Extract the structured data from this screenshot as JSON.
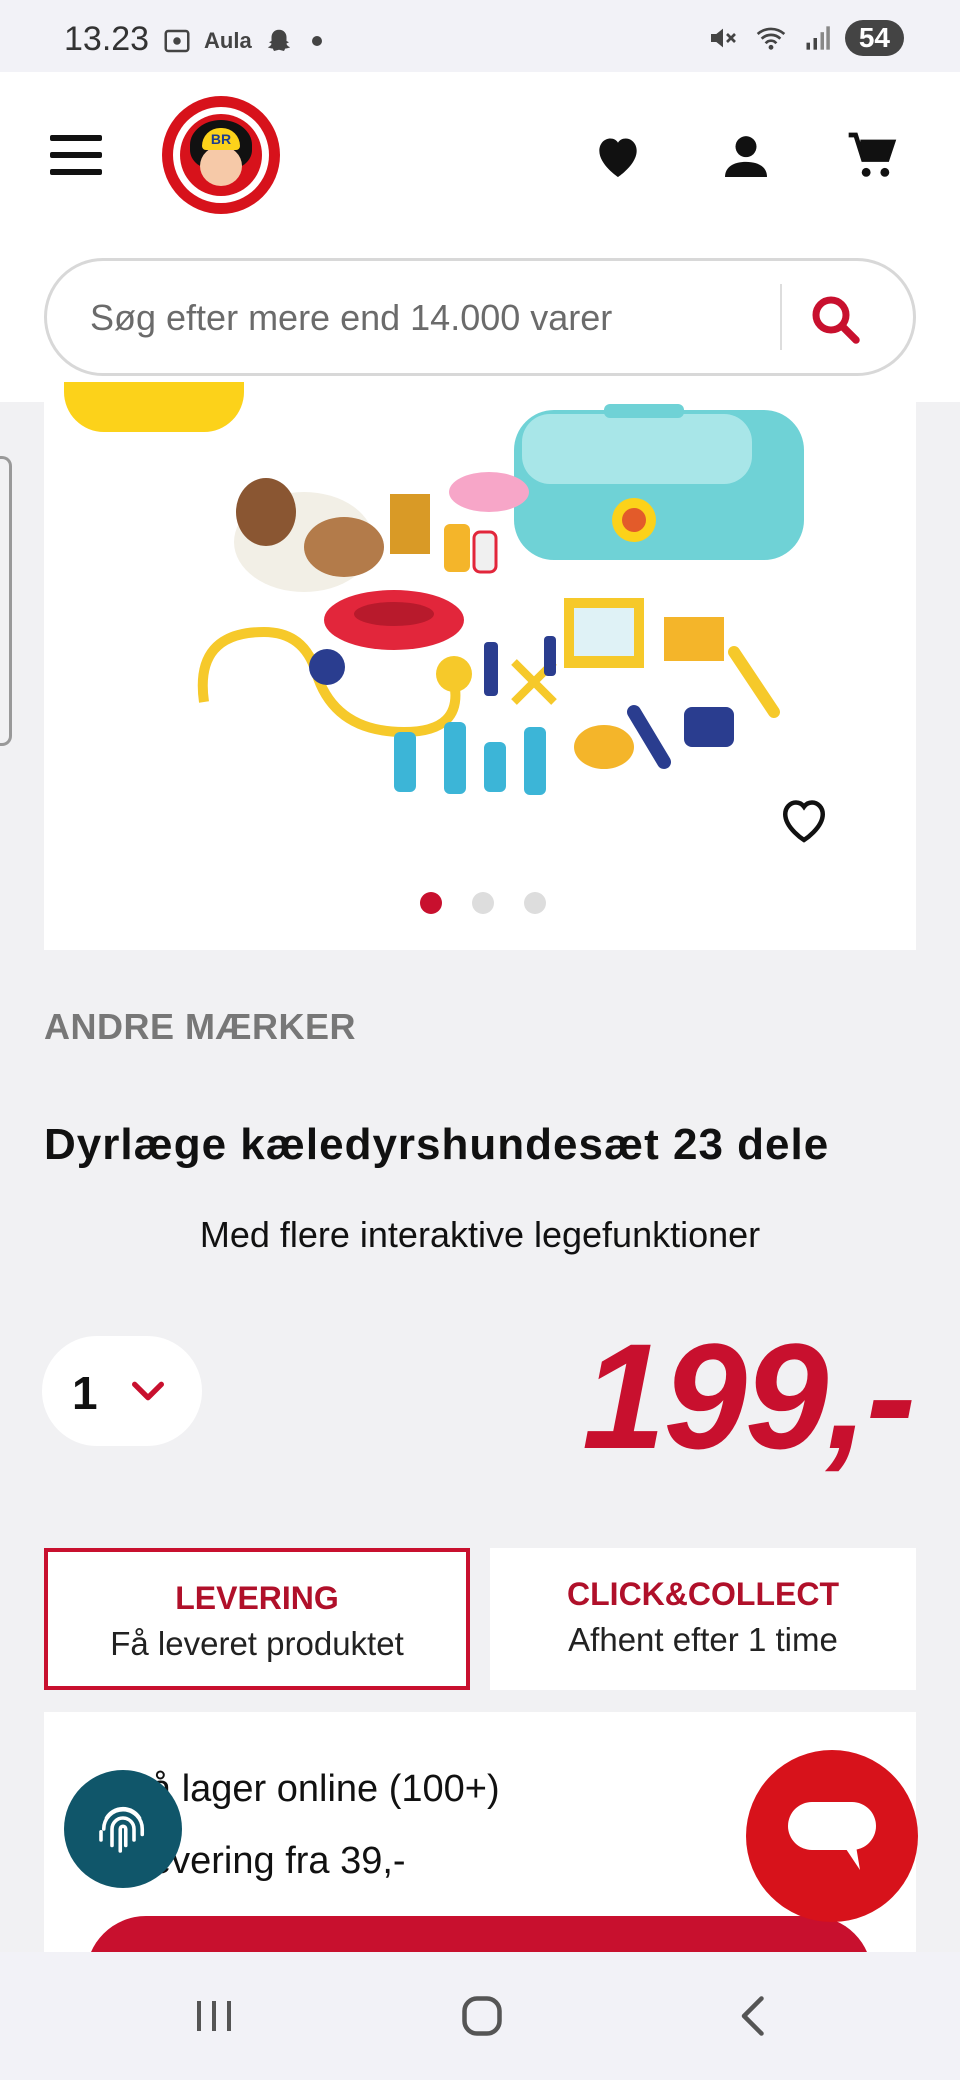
{
  "status_bar": {
    "time": "13.23",
    "left_icons": [
      "screenshot-icon",
      "Aula",
      "snapchat-icon",
      "dot"
    ],
    "aula_label": "Aula",
    "battery": "54"
  },
  "header": {
    "logo_cap_text": "BR",
    "search_placeholder": "Søg efter mere end 14.000 varer"
  },
  "product": {
    "brand": "ANDRE MÆRKER",
    "title": "Dyrlæge kæledyrshundesæt 23 dele",
    "subtitle": "Med flere interaktive legefunktioner",
    "quantity": "1",
    "price": "199,-",
    "image_dots": 3,
    "active_dot": 0
  },
  "delivery": {
    "tabs": [
      {
        "title": "LEVERING",
        "subtitle": "Få leveret produktet",
        "active": true
      },
      {
        "title": "CLICK&COLLECT",
        "subtitle": "Afhent efter 1 time",
        "active": false
      }
    ],
    "stock_line": "å lager online (100+)",
    "delivery_line": "evering fra 39,-"
  },
  "colors": {
    "brand_red": "#c8102e",
    "accent_yellow": "#fcd21a",
    "fingerprint_bg": "#10566a"
  }
}
